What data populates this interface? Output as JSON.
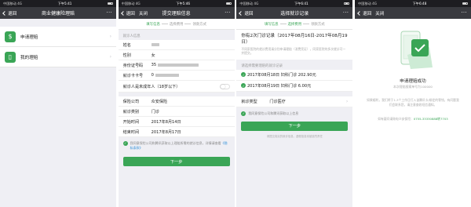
{
  "status": {
    "carrier": "中国移动",
    "network": "4G",
    "times": [
      "下午5:41",
      "下午5:46",
      "下午6:41",
      "下午6:48"
    ]
  },
  "screens": {
    "s1": {
      "nav": {
        "back": "退回",
        "title": "商业健康险理赔"
      },
      "menu": [
        {
          "label": "申请理赔",
          "icon": "dollar-icon"
        },
        {
          "label": "我的理赔",
          "icon": "document-icon"
        }
      ]
    },
    "s2": {
      "nav": {
        "back": "退回",
        "close": "关闭",
        "title": "提交理赔信息"
      },
      "steps": [
        "填写信息",
        "选择费用",
        "领款方式"
      ],
      "section": "就诊人信息",
      "rows": [
        {
          "k": "姓名",
          "v": ""
        },
        {
          "k": "性别",
          "v": "女"
        },
        {
          "k": "身份证号码",
          "v": "35"
        },
        {
          "k": "就诊卡卡号",
          "v": "0"
        },
        {
          "k": "就诊人是未成年人（18岁以下）",
          "v": ""
        }
      ],
      "rows2": [
        {
          "k": "保险公司",
          "v": "众安保险"
        },
        {
          "k": "就诊类别",
          "v": "门诊"
        },
        {
          "k": "开始时间",
          "v": "2017年8月14日"
        },
        {
          "k": "结束时间",
          "v": "2017年8月17日"
        }
      ],
      "agree_text": "我同意保险公司和腾讯获取以上理赔所需的就诊信息，详情请查看",
      "agree_link": "《隐私条款》",
      "button": "下一步"
    },
    "s3": {
      "nav": {
        "back": "退回",
        "title": "选择就诊记录"
      },
      "steps": [
        "填写信息",
        "选择费用",
        "领款方式"
      ],
      "notice_title": "你有2次门诊记录（2017年08月16日-2017年08月19日）",
      "notice_desc": "不同家医院的就诊费用请分别申请理赔（消费凭证），同家医院的多次就诊可一并提交。",
      "section": "请选择需要理赔的就诊记录",
      "records": [
        {
          "date": "2017年08月18日",
          "desc": "妇科门诊",
          "amount": "202.90元"
        },
        {
          "date": "2017年08月19日",
          "desc": "妇科门诊",
          "amount": "6.00元"
        }
      ],
      "type_k": "就诊类型",
      "type_v": "门诊医疗",
      "agree_text": "我同意保险公司和腾讯获取以上信息",
      "button": "下一步",
      "footnote": "请提交真实的就诊信息，虚假信息将被追究责任"
    },
    "s4": {
      "nav": {
        "back": "退回",
        "close": "关闭"
      },
      "title": "申请理赔成功",
      "sub": "本次理赔报案单号为100000",
      "note": "如果顺利，我们将于1-3个工作日打入该腾讯卡/绑定的零钱，有问题我们会联系您，请注意查收短信通知。",
      "phone_label": "如有疑问请致电众安保险：",
      "phone": "0755-33330888转7703"
    }
  },
  "colors": {
    "accent": "#3aa556",
    "nav_bg": "#393a3f",
    "status_bg": "#1d1d21"
  }
}
